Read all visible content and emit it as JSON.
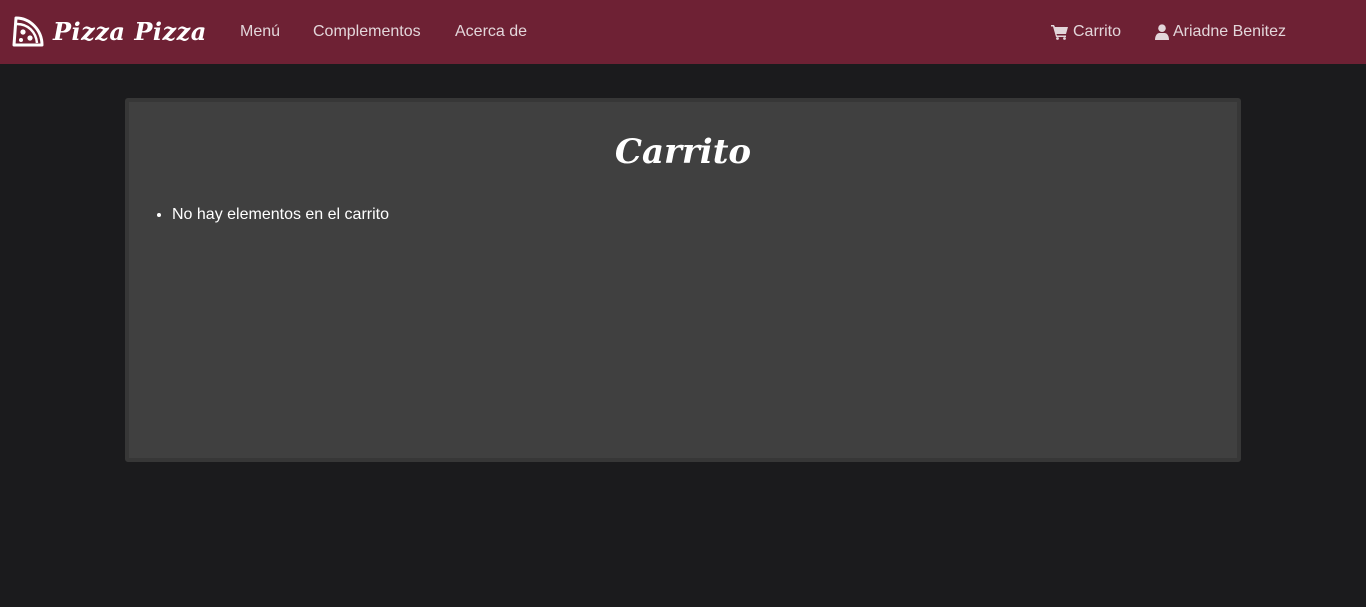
{
  "navbar": {
    "brand": "Pizza Pizza",
    "brand_icon": "pizza-slice-icon",
    "links": [
      "Menú",
      "Complementos",
      "Acerca de"
    ],
    "cart": {
      "label": "Carrito",
      "icon": "shopping-cart-icon"
    },
    "user": {
      "label": "Ariadne Benitez",
      "icon": "user-icon"
    }
  },
  "cart_panel": {
    "title": "Carrito",
    "items": [
      "No hay elementos en el carrito"
    ]
  },
  "colors": {
    "navbar": "#6e2134",
    "page_background": "#1b1b1d",
    "panel": "#404040"
  }
}
